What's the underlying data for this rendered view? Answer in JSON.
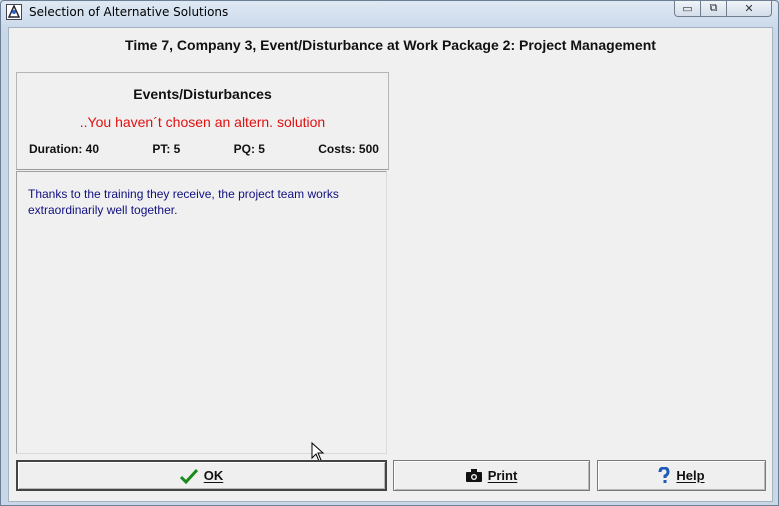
{
  "window": {
    "title": "Selection of Alternative Solutions",
    "caption_buttons": {
      "minimize": "▭",
      "maximize": "⧉",
      "close": "✕"
    }
  },
  "header": {
    "title": "Time 7, Company 3, Event/Disturbance at Work Package 2: Project Management"
  },
  "events": {
    "title": "Events/Disturbances",
    "warning": "..You haven´t chosen an altern. solution",
    "warning_color": "#e01010",
    "stats": {
      "duration": "Duration: 40",
      "pt": "PT: 5",
      "pq": "PQ: 5",
      "costs": "Costs: 500"
    }
  },
  "description": {
    "text": "Thanks to the training they receive, the project team works extraordinarily well together."
  },
  "buttons": {
    "ok": {
      "label": "OK",
      "icon": "check-icon"
    },
    "print": {
      "label": "Print",
      "icon": "camera-icon"
    },
    "help": {
      "label": "Help",
      "icon": "question-icon"
    }
  }
}
